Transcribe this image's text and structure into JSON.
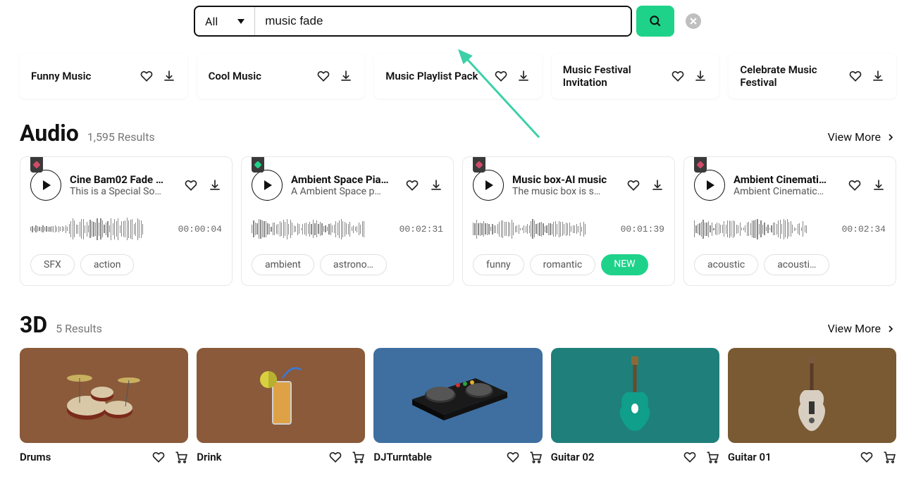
{
  "search": {
    "filter_label": "All",
    "query": "music fade"
  },
  "suggestions": [
    {
      "title": "Funny Music"
    },
    {
      "title": "Cool Music"
    },
    {
      "title": "Music Playlist Pack"
    },
    {
      "title": "Music Festival Invitation"
    },
    {
      "title": "Celebrate Music Festival"
    }
  ],
  "audio_section": {
    "title": "Audio",
    "count": "1,595 Results",
    "view_more": "View More"
  },
  "audio": [
    {
      "badge": "pink",
      "title": "Cine Bam02 Fade …",
      "subtitle": "This is a Special So…",
      "duration": "00:00:04",
      "tags": [
        "SFX",
        "action"
      ]
    },
    {
      "badge": "green",
      "title": "Ambient Space Pia…",
      "subtitle": "A Ambient Space p…",
      "duration": "00:02:31",
      "tags": [
        "ambient",
        "astrono…"
      ]
    },
    {
      "badge": "pink",
      "title": "Music box-AI music",
      "subtitle": "The music box is s…",
      "duration": "00:01:39",
      "tags": [
        "funny",
        "romantic"
      ],
      "new_label": "NEW"
    },
    {
      "badge": "pink",
      "title": "Ambient Cinemati…",
      "subtitle": "Ambient Cinematic…",
      "duration": "00:02:34",
      "tags": [
        "acoustic",
        "acousti…"
      ]
    }
  ],
  "td_section": {
    "title": "3D",
    "count": "5 Results",
    "view_more": "View More"
  },
  "td": [
    {
      "title": "Drums",
      "bg": "#8a5a3a"
    },
    {
      "title": "Drink",
      "bg": "#8a5a3a"
    },
    {
      "title": "DJTurntable",
      "bg": "#3e6fa0"
    },
    {
      "title": "Guitar 02",
      "bg": "#1f7f7a"
    },
    {
      "title": "Guitar 01",
      "bg": "#7a5a32"
    }
  ]
}
